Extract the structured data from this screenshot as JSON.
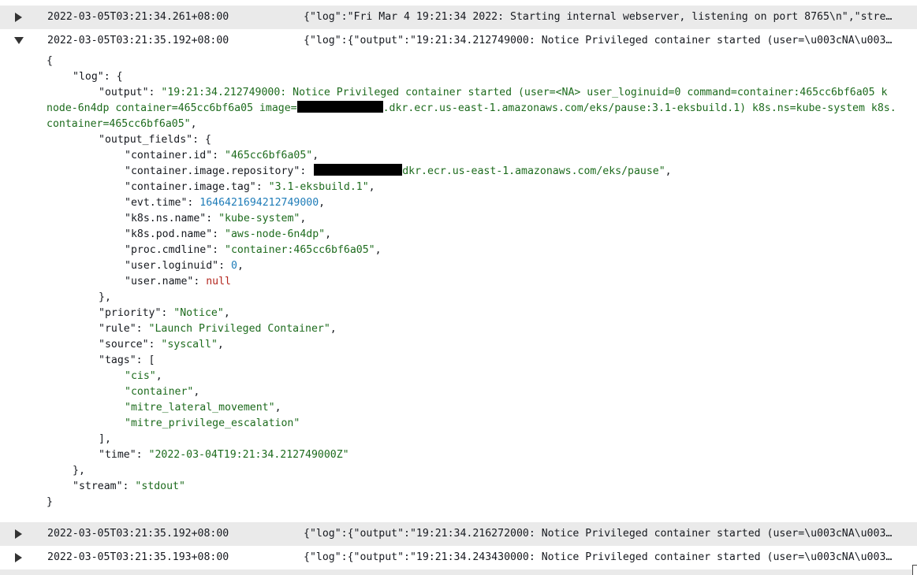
{
  "rows": [
    {
      "timestamp": "2022-03-05T03:21:34.261+08:00",
      "message": "{\"log\":\"Fri Mar 4 19:21:34 2022: Starting internal webserver, listening on port 8765\\n\",\"stre…",
      "expanded": false,
      "caret_icon": "triangle-right-icon"
    },
    {
      "timestamp": "2022-03-05T03:21:35.192+08:00",
      "message": "{\"log\":{\"output\":\"19:21:34.212749000: Notice Privileged container started (user=\\u003cNA\\u003…",
      "expanded": true,
      "caret_icon": "triangle-down-icon"
    },
    {
      "timestamp": "2022-03-05T03:21:35.192+08:00",
      "message": "{\"log\":{\"output\":\"19:21:34.216272000: Notice Privileged container started (user=\\u003cNA\\u003…",
      "expanded": false,
      "caret_icon": "triangle-right-icon"
    },
    {
      "timestamp": "2022-03-05T03:21:35.193+08:00",
      "message": "{\"log\":{\"output\":\"19:21:34.243430000: Notice Privileged container started (user=\\u003cNA\\u003…",
      "expanded": false,
      "caret_icon": "triangle-right-icon"
    }
  ],
  "detail": {
    "open_brace": "{",
    "log_key": "\"log\"",
    "output_key": "\"output\"",
    "output_line1": "\"19:21:34.212749000: Notice Privileged container started (user=<NA> user_loginuid=0 command=container:465cc6bf6a05 k",
    "output_line2_a": "node-6n4dp container=465cc6bf6a05 image=",
    "output_line2_b": ".dkr.ecr.us-east-1.amazonaws.com/eks/pause:3.1-eksbuild.1) k8s.ns=kube-system k8s.",
    "output_line3": "container=465cc6bf6a05\"",
    "output_fields_key": "\"output_fields\"",
    "fields": [
      {
        "key": "\"container.id\"",
        "value": "\"465cc6bf6a05\"",
        "type": "string"
      },
      {
        "key": "\"container.image.repository\"",
        "value": "dkr.ecr.us-east-1.amazonaws.com/eks/pause\"",
        "type": "string",
        "redacted_prefix": true
      },
      {
        "key": "\"container.image.tag\"",
        "value": "\"3.1-eksbuild.1\"",
        "type": "string"
      },
      {
        "key": "\"evt.time\"",
        "value": "1646421694212749000",
        "type": "number"
      },
      {
        "key": "\"k8s.ns.name\"",
        "value": "\"kube-system\"",
        "type": "string"
      },
      {
        "key": "\"k8s.pod.name\"",
        "value": "\"aws-node-6n4dp\"",
        "type": "string"
      },
      {
        "key": "\"proc.cmdline\"",
        "value": "\"container:465cc6bf6a05\"",
        "type": "string"
      },
      {
        "key": "\"user.loginuid\"",
        "value": "0",
        "type": "number"
      },
      {
        "key": "\"user.name\"",
        "value": "null",
        "type": "null"
      }
    ],
    "priority_key": "\"priority\"",
    "priority_value": "\"Notice\"",
    "rule_key": "\"rule\"",
    "rule_value": "\"Launch Privileged Container\"",
    "source_key": "\"source\"",
    "source_value": "\"syscall\"",
    "tags_key": "\"tags\"",
    "tags": [
      "\"cis\"",
      "\"container\"",
      "\"mitre_lateral_movement\"",
      "\"mitre_privilege_escalation\""
    ],
    "time_key": "\"time\"",
    "time_value": "\"2022-03-04T19:21:34.212749000Z\"",
    "stream_key": "\"stream\"",
    "stream_value": "\"stdout\"",
    "close_brace": "}"
  },
  "colors": {
    "row_shade": "#eaeaea",
    "string": "#1d6b1d",
    "number": "#1e7cb8",
    "null": "#b3261e",
    "text": "#16191f"
  }
}
